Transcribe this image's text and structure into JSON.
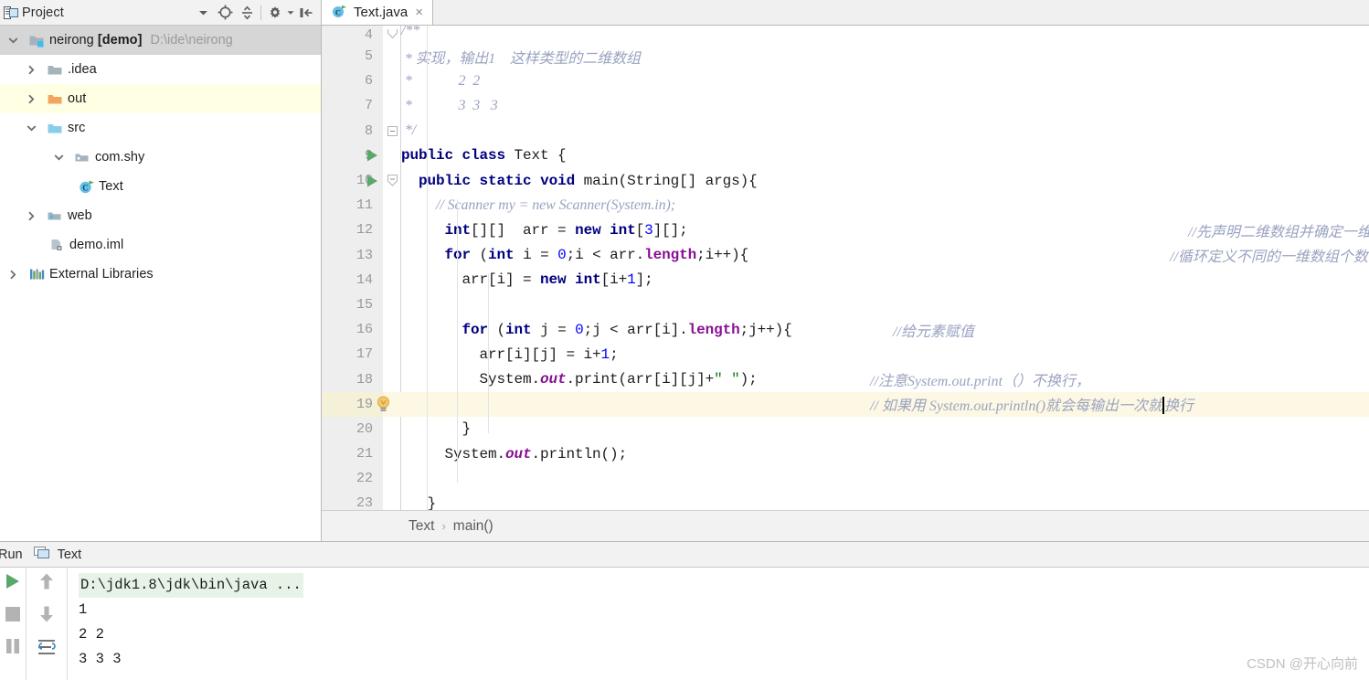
{
  "project_panel": {
    "title": "Project",
    "icons": [
      "project-window-icon",
      "chevron-down-icon",
      "locate-crosshair-icon",
      "collapse-all-icon",
      "gear-icon",
      "gear-dropdown-icon",
      "hide-panel-icon"
    ],
    "tree": [
      {
        "label": "neirong",
        "bold_label": "[demo]",
        "path": "D:\\ide\\neirong",
        "icon": "module-folder-icon",
        "arrow": "chevron-down",
        "indent": 0,
        "state": "selected"
      },
      {
        "label": ".idea",
        "icon": "folder-gray-icon",
        "arrow": "chevron-right",
        "indent": 1,
        "state": "normal"
      },
      {
        "label": "out",
        "icon": "folder-orange-icon",
        "arrow": "chevron-right",
        "indent": 1,
        "state": "highlight"
      },
      {
        "label": "src",
        "icon": "folder-blue-icon",
        "arrow": "chevron-down",
        "indent": 1,
        "state": "normal"
      },
      {
        "label": "com.shy",
        "icon": "package-icon",
        "arrow": "chevron-down",
        "indent": 2,
        "state": "normal"
      },
      {
        "label": "Text",
        "icon": "java-class-icon",
        "arrow": "none",
        "indent": 3,
        "state": "normal"
      },
      {
        "label": "web",
        "icon": "web-folder-icon",
        "arrow": "chevron-right",
        "indent": 1,
        "state": "normal"
      },
      {
        "label": "demo.iml",
        "icon": "iml-file-icon",
        "arrow": "none",
        "indent": 2,
        "state": "normal"
      },
      {
        "label": "External Libraries",
        "icon": "libraries-icon",
        "arrow": "chevron-right",
        "indent": 0,
        "state": "normal"
      }
    ]
  },
  "editor": {
    "tab": {
      "label": "Text.java",
      "icon": "java-class-icon",
      "close": "×"
    },
    "breadcrumb": {
      "class": "Text",
      "separator": "›",
      "method": "main()"
    },
    "lines": [
      {
        "no": "4",
        "gutter": "",
        "fold": "fold-start",
        "partial": true
      },
      {
        "no": "5",
        "gutter": "",
        "fold": ""
      },
      {
        "no": "6",
        "gutter": "",
        "fold": ""
      },
      {
        "no": "7",
        "gutter": "",
        "fold": ""
      },
      {
        "no": "8",
        "gutter": "",
        "fold": "fold-end"
      },
      {
        "no": "9",
        "gutter": "run-arrow",
        "fold": ""
      },
      {
        "no": "10",
        "gutter": "run-arrow",
        "fold": "fold-collapse"
      },
      {
        "no": "11",
        "gutter": "",
        "fold": ""
      },
      {
        "no": "12",
        "gutter": "",
        "fold": ""
      },
      {
        "no": "13",
        "gutter": "",
        "fold": ""
      },
      {
        "no": "14",
        "gutter": "",
        "fold": ""
      },
      {
        "no": "15",
        "gutter": "",
        "fold": ""
      },
      {
        "no": "16",
        "gutter": "",
        "fold": ""
      },
      {
        "no": "17",
        "gutter": "",
        "fold": ""
      },
      {
        "no": "18",
        "gutter": "",
        "fold": ""
      },
      {
        "no": "19",
        "gutter": "intention-bulb",
        "fold": "",
        "highlight": true
      },
      {
        "no": "20",
        "gutter": "",
        "fold": ""
      },
      {
        "no": "21",
        "gutter": "",
        "fold": ""
      },
      {
        "no": "22",
        "gutter": "",
        "fold": ""
      },
      {
        "no": "23",
        "gutter": "",
        "fold": ""
      }
    ],
    "code": {
      "l4": "/**",
      "l5": " * 实现，输出1    这样类型的二维数组",
      "l6": " *             2  2",
      "l7": " *             3  3   3",
      "l8": " */",
      "l9_kw1": "public",
      "l9_kw2": "class",
      "l9_name": " Text {",
      "l10_kw1": "public",
      "l10_kw2": "static",
      "l10_kw3": "void",
      "l10_rest": " main(String[] args){",
      "l11": "// Scanner my = new Scanner(System.in);",
      "l12_a": "int",
      "l12_b": "[][]  arr = ",
      "l12_c": "new",
      "l12_d": " ",
      "l12_e": "int",
      "l12_f": "[",
      "l12_g": "3",
      "l12_h": "][];",
      "l13_a": "for",
      "l13_b": " (",
      "l13_c": "int",
      "l13_d": " i = ",
      "l13_e": "0",
      "l13_f": ";i < arr.",
      "l13_g": "length",
      "l13_h": ";i++){",
      "l14_a": "arr[i] = ",
      "l14_b": "new",
      "l14_c": " ",
      "l14_d": "int",
      "l14_e": "[i+",
      "l14_f": "1",
      "l14_g": "];",
      "l16_a": "for",
      "l16_b": " (",
      "l16_c": "int",
      "l16_d": " j = ",
      "l16_e": "0",
      "l16_f": ";j < arr[i].",
      "l16_g": "length",
      "l16_h": ";j++){",
      "l17_a": "arr[i][j] = i+",
      "l17_b": "1",
      "l17_c": ";",
      "l18_a": "System.",
      "l18_b": "out",
      "l18_c": ".print(arr[i][j]+",
      "l18_d": "\" \"",
      "l18_e": ");",
      "l20": "}",
      "l21_a": "System.",
      "l21_b": "out",
      "l21_c": ".println();",
      "l23": "}"
    },
    "side_comments": {
      "c12": "//先声明二维数组并确定一维数组的个数",
      "c13": "//循环定义不同的一维数组个数",
      "c16": "//给元素赋值",
      "c18": "//注意System.out.print（）不换行，",
      "c19_left": "// 如果用 System.out.println()就会每输出一次就",
      "c19_right": "换行"
    }
  },
  "run_panel": {
    "title": "Run",
    "tab_label": "Text",
    "tab_icon": "console-icon",
    "actions": [
      "run-play-icon",
      "stop-icon",
      "pause-icon"
    ],
    "actions2": [
      "arrow-up-icon",
      "arrow-down-icon",
      "soft-wrap-icon"
    ],
    "console": [
      {
        "text": "D:\\jdk1.8\\jdk\\bin\\java ...",
        "style": "command"
      },
      {
        "text": "1",
        "style": "output"
      },
      {
        "text": "2 2",
        "style": "output"
      },
      {
        "text": "3 3 3",
        "style": "output"
      }
    ]
  },
  "watermark": {
    "text": "CSDN @开心向前"
  },
  "colors": {
    "keyword": "#000080",
    "number": "#0000ff",
    "field": "#871094",
    "string": "#067d17",
    "comment": "#9aa3c0",
    "highlight_row": "#fdf8e3",
    "tree_highlight": "#ffffe4",
    "tree_selected": "#d6d6d6"
  }
}
